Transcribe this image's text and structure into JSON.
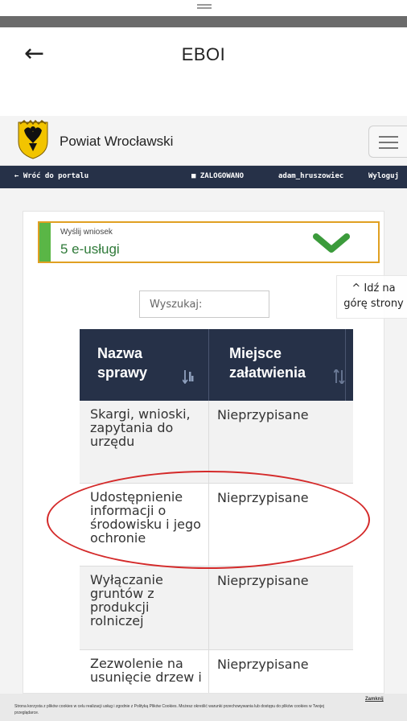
{
  "app": {
    "title": "EBOI"
  },
  "site": {
    "name": "Powiat Wrocławski"
  },
  "portal_bar": {
    "back_label": "← Wróć do portalu",
    "status_label": "ZALOGOWANO",
    "username": "adam_hruszowiec",
    "logout_label": "Wyloguj"
  },
  "service_box": {
    "label": "Wyślij wniosek",
    "count": "5 e-usługi",
    "accent": "#5ab646",
    "border": "#e0a022"
  },
  "search": {
    "placeholder": "Wyszukaj:"
  },
  "table": {
    "headers": [
      "Nazwa sprawy",
      "Miejsce załatwienia"
    ],
    "rows": [
      [
        "Skargi, wnioski, zapytania do urzędu",
        "Nieprzypisane"
      ],
      [
        "Udostępnienie informacji o środowisku i jego ochronie",
        "Nieprzypisane"
      ],
      [
        "Wyłączanie gruntów z produkcji rolniczej",
        "Nieprzypisane"
      ],
      [
        "Zezwolenie na usunięcie drzew i",
        "Nieprzypisane"
      ]
    ]
  },
  "goto_top": {
    "line1": "Idź na",
    "line2": "górę strony"
  },
  "cookie": {
    "text": "Strona korzysta z plików cookies w celu realizacji usług i zgodnie z Polityką Plików Cookies. Możesz określić warunki przechowywania lub dostępu do plików cookies w Twojej przeglądarce.",
    "close_label": "Zamknij"
  },
  "colors": {
    "navy": "#263148",
    "highlight": "#d42a2a"
  }
}
